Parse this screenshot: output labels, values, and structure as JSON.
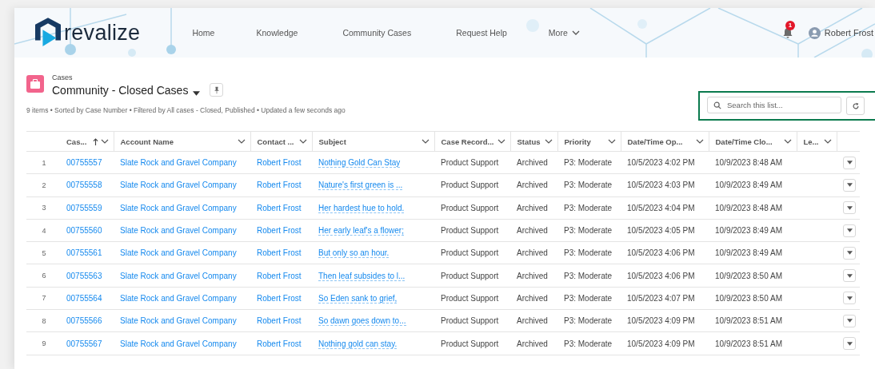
{
  "header": {
    "logo_text": "revalize",
    "nav": [
      {
        "label": "Home",
        "dropdown": false
      },
      {
        "label": "Knowledge",
        "dropdown": false
      },
      {
        "label": "Community Cases",
        "dropdown": false
      },
      {
        "label": "Request Help",
        "dropdown": false
      },
      {
        "label": "More",
        "dropdown": true
      }
    ],
    "notification_count": "1",
    "user_name": "Robert Frost"
  },
  "list_header": {
    "object_label": "Cases",
    "title": "Community - Closed Cases",
    "summary": "9 items • Sorted by Case Number • Filtered by All cases - Closed, Published • Updated a few seconds ago"
  },
  "search": {
    "placeholder": "Search this list..."
  },
  "table": {
    "columns": [
      {
        "label": "Cas...",
        "sorted": true
      },
      {
        "label": "Account Name",
        "sorted": false
      },
      {
        "label": "Contact ...",
        "sorted": false
      },
      {
        "label": "Subject",
        "sorted": false
      },
      {
        "label": "Case Record...",
        "sorted": false
      },
      {
        "label": "Status",
        "sorted": false
      },
      {
        "label": "Priority",
        "sorted": false
      },
      {
        "label": "Date/Time Op...",
        "sorted": false
      },
      {
        "label": "Date/Time Clo...",
        "sorted": false
      },
      {
        "label": "Le...",
        "sorted": false
      }
    ],
    "rows": [
      {
        "number": "1",
        "case_number": "00755557",
        "account": "Slate Rock and Gravel Company",
        "contact": "Robert Frost",
        "subject": "Nothing Gold Can Stay",
        "record_type": "Product Support",
        "status": "Archived",
        "priority": "P3: Moderate",
        "opened": "10/5/2023 4:02 PM",
        "closed": "10/9/2023 8:48 AM"
      },
      {
        "number": "2",
        "case_number": "00755558",
        "account": "Slate Rock and Gravel Company",
        "contact": "Robert Frost",
        "subject": "Nature's first green is ...",
        "record_type": "Product Support",
        "status": "Archived",
        "priority": "P3: Moderate",
        "opened": "10/5/2023 4:03 PM",
        "closed": "10/9/2023 8:49 AM"
      },
      {
        "number": "3",
        "case_number": "00755559",
        "account": "Slate Rock and Gravel Company",
        "contact": "Robert Frost",
        "subject": "Her hardest hue to hold.",
        "record_type": "Product Support",
        "status": "Archived",
        "priority": "P3: Moderate",
        "opened": "10/5/2023 4:04 PM",
        "closed": "10/9/2023 8:48 AM"
      },
      {
        "number": "4",
        "case_number": "00755560",
        "account": "Slate Rock and Gravel Company",
        "contact": "Robert Frost",
        "subject": "Her early leaf's a flower;",
        "record_type": "Product Support",
        "status": "Archived",
        "priority": "P3: Moderate",
        "opened": "10/5/2023 4:05 PM",
        "closed": "10/9/2023 8:49 AM"
      },
      {
        "number": "5",
        "case_number": "00755561",
        "account": "Slate Rock and Gravel Company",
        "contact": "Robert Frost",
        "subject": "But only so an hour.",
        "record_type": "Product Support",
        "status": "Archived",
        "priority": "P3: Moderate",
        "opened": "10/5/2023 4:06 PM",
        "closed": "10/9/2023 8:49 AM"
      },
      {
        "number": "6",
        "case_number": "00755563",
        "account": "Slate Rock and Gravel Company",
        "contact": "Robert Frost",
        "subject": "Then leaf subsides to l...",
        "record_type": "Product Support",
        "status": "Archived",
        "priority": "P3: Moderate",
        "opened": "10/5/2023 4:06 PM",
        "closed": "10/9/2023 8:50 AM"
      },
      {
        "number": "7",
        "case_number": "00755564",
        "account": "Slate Rock and Gravel Company",
        "contact": "Robert Frost",
        "subject": "So Eden sank to grief,",
        "record_type": "Product Support",
        "status": "Archived",
        "priority": "P3: Moderate",
        "opened": "10/5/2023 4:07 PM",
        "closed": "10/9/2023 8:50 AM"
      },
      {
        "number": "8",
        "case_number": "00755566",
        "account": "Slate Rock and Gravel Company",
        "contact": "Robert Frost",
        "subject": "So dawn goes down to...",
        "record_type": "Product Support",
        "status": "Archived",
        "priority": "P3: Moderate",
        "opened": "10/5/2023 4:09 PM",
        "closed": "10/9/2023 8:51 AM"
      },
      {
        "number": "9",
        "case_number": "00755567",
        "account": "Slate Rock and Gravel Company",
        "contact": "Robert Frost",
        "subject": "Nothing gold can stay.",
        "record_type": "Product Support",
        "status": "Archived",
        "priority": "P3: Moderate",
        "opened": "10/5/2023 4:09 PM",
        "closed": "10/9/2023 8:51 AM"
      }
    ]
  }
}
